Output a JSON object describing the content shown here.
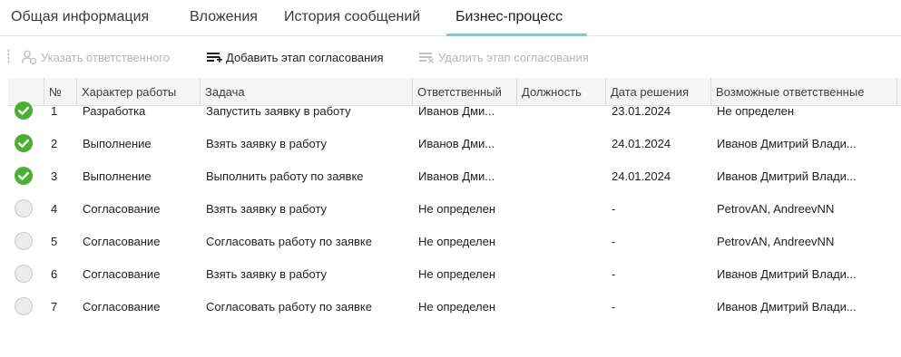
{
  "tabs": [
    {
      "label": "Общая информация"
    },
    {
      "label": "Вложения"
    },
    {
      "label": "История сообщений"
    },
    {
      "label": "Бизнес-процесс"
    }
  ],
  "active_tab": "Бизнес-процесс",
  "toolbar": {
    "assign_label": "Указать ответственного",
    "add_stage_label": "Добавить этап согласования",
    "delete_stage_label": "Удалить этап согласования"
  },
  "colors": {
    "done": "#4caf34",
    "tab_underline": "#7fc3e6",
    "disabled_text": "#b6b6b6"
  },
  "columns": {
    "num": "№",
    "work_type": "Характер работы",
    "task": "Задача",
    "responsible": "Ответственный",
    "position": "Должность",
    "decision_date": "Дата решения",
    "possible": "Возможные ответственные"
  },
  "rows": [
    {
      "status": "done",
      "num": "1",
      "work_type": "Разработка",
      "task": "Запустить заявку в работу",
      "responsible": "Иванов Дми...",
      "position": "",
      "decision_date": "23.01.2024",
      "possible": "Не определен"
    },
    {
      "status": "done",
      "num": "2",
      "work_type": "Выполнение",
      "task": "Взять заявку в работу",
      "responsible": "Иванов Дми...",
      "position": "",
      "decision_date": "24.01.2024",
      "possible": "Иванов Дмитрий Влади..."
    },
    {
      "status": "done",
      "num": "3",
      "work_type": "Выполнение",
      "task": "Выполнить работу по заявке",
      "responsible": "Иванов Дми...",
      "position": "",
      "decision_date": "24.01.2024",
      "possible": "Иванов Дмитрий Влади..."
    },
    {
      "status": "pending",
      "num": "4",
      "work_type": "Согласование",
      "task": "Взять заявку в работу",
      "responsible": "Не определен",
      "position": "",
      "decision_date": "-",
      "possible": "PetrovAN, AndreevNN"
    },
    {
      "status": "pending",
      "num": "5",
      "work_type": "Согласование",
      "task": "Согласовать работу по заявке",
      "responsible": "Не определен",
      "position": "",
      "decision_date": "-",
      "possible": "PetrovAN, AndreevNN"
    },
    {
      "status": "pending",
      "num": "6",
      "work_type": "Согласование",
      "task": "Взять заявку в работу",
      "responsible": "Не определен",
      "position": "",
      "decision_date": "-",
      "possible": "Иванов Дмитрий Влади..."
    },
    {
      "status": "pending",
      "num": "7",
      "work_type": "Согласование",
      "task": "Согласовать работу по заявке",
      "responsible": "Не определен",
      "position": "",
      "decision_date": "-",
      "possible": "Иванов Дмитрий Влади..."
    }
  ]
}
